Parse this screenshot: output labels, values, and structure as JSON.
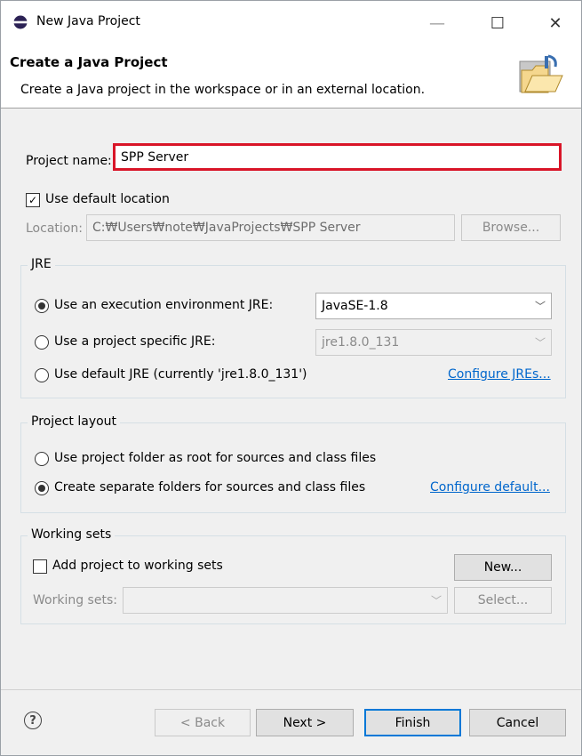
{
  "window": {
    "title": "New Java Project",
    "min": "—",
    "max": "☐",
    "close": "✕"
  },
  "header": {
    "title": "Create a Java Project",
    "description": "Create a Java project in the workspace or in an external location."
  },
  "project_name": {
    "label": "Project name:",
    "value": "SPP Server"
  },
  "location": {
    "use_default_label": "Use default location",
    "use_default_checked": true,
    "label": "Location:",
    "value": "C:₩Users₩note₩JavaProjects₩SPP Server",
    "browse": "Browse..."
  },
  "jre": {
    "group_title": "JRE",
    "option1": "Use an execution environment JRE:",
    "option1_value": "JavaSE-1.8",
    "option2": "Use a project specific JRE:",
    "option2_value": "jre1.8.0_131",
    "option3": "Use default JRE (currently 'jre1.8.0_131')",
    "configure_link": "Configure JREs..."
  },
  "layout": {
    "group_title": "Project layout",
    "option1": "Use project folder as root for sources and class files",
    "option2": "Create separate folders for sources and class files",
    "configure_link": "Configure default..."
  },
  "working_sets": {
    "group_title": "Working sets",
    "add_label": "Add project to working sets",
    "new_button": "New...",
    "label": "Working sets:",
    "select_button": "Select..."
  },
  "footer": {
    "help": "?",
    "back": "< Back",
    "next": "Next >",
    "finish": "Finish",
    "cancel": "Cancel"
  },
  "icons": {
    "app": "eclipse-icon",
    "header": "folder-wizard-icon",
    "help": "help-icon"
  },
  "colors": {
    "highlight": "#d91528",
    "link": "#0066cc",
    "accent": "#0078d7"
  }
}
